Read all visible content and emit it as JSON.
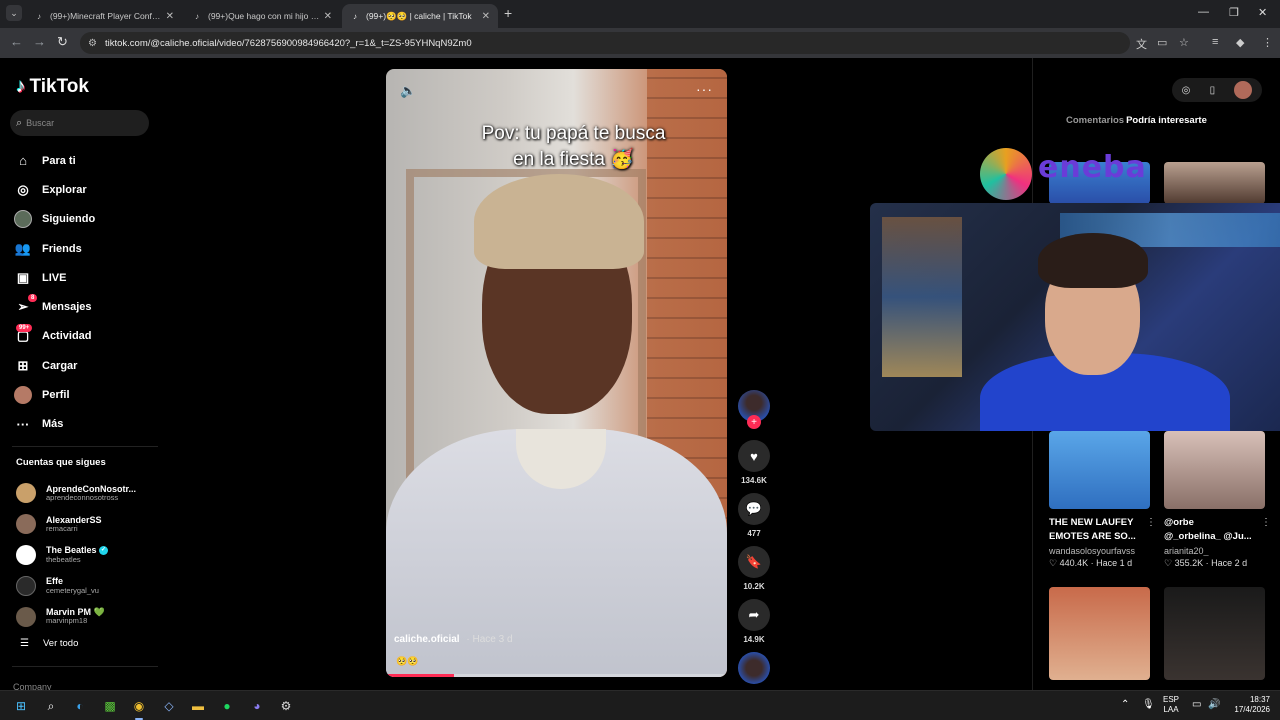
{
  "browser": {
    "tabs": [
      {
        "title": "(99+)Minecraft Player Confused",
        "active": false
      },
      {
        "title": "(99+)Que hago con mi hijo 😳 (",
        "active": false
      },
      {
        "title": "(99+)🥺🥺 | caliche | TikTok",
        "active": true
      }
    ],
    "url": "tiktok.com/@caliche.oficial/video/7628756900984966420?_r=1&_t=ZS-95YHNqN9Zm0"
  },
  "tiktok": {
    "logo": "TikTok",
    "search_placeholder": "Buscar",
    "nav": [
      {
        "label": "Para ti",
        "icon": "home-icon"
      },
      {
        "label": "Explorar",
        "icon": "compass-icon"
      },
      {
        "label": "Siguiendo",
        "icon": "following-avatar-icon"
      },
      {
        "label": "Friends",
        "icon": "friends-icon"
      },
      {
        "label": "LIVE",
        "icon": "live-icon"
      },
      {
        "label": "Mensajes",
        "icon": "messages-icon",
        "badge": "8"
      },
      {
        "label": "Actividad",
        "icon": "activity-icon",
        "badge": "99+"
      },
      {
        "label": "Cargar",
        "icon": "upload-icon"
      },
      {
        "label": "Perfil",
        "icon": "profile-avatar-icon"
      },
      {
        "label": "Más",
        "icon": "more-icon"
      }
    ],
    "following_title": "Cuentas que sigues",
    "following": [
      {
        "name": "AprendeConNosotr...",
        "handle": "aprendeconnosotross",
        "color": "#c9a06a"
      },
      {
        "name": "AlexanderSS",
        "handle": "remacarri",
        "color": "#8a6b5a"
      },
      {
        "name": "The Beatles",
        "handle": "thebeatles",
        "color": "#ffffff",
        "verified": true
      },
      {
        "name": "Effe",
        "handle": "cemeterygal_vu",
        "color": "#2a2a2a"
      },
      {
        "name": "Marvin PM 💚",
        "handle": "marvinpm18",
        "color": "#6a5a4a"
      }
    ],
    "see_all": "Ver todo",
    "company": "Company"
  },
  "video": {
    "caption_line1": "Pov: tu papá te busca",
    "caption_line2": "en la fiesta 🥳",
    "author": "caliche.oficial",
    "time": "· Hace 3 d",
    "emoji": "🥺🥺",
    "progress": 0.2,
    "likes": "134.6K",
    "comments": "477",
    "saves": "10.2K",
    "shares": "14.9K"
  },
  "right_panel": {
    "tabs": [
      "Comentarios",
      "Podría interesarte"
    ],
    "cards": [
      {
        "title": "THE NEW LAUFEY",
        "title2": "EMOTES ARE SO...",
        "author": "wandasolosyourfavss",
        "stats": "♡ 440.4K · Hace 1 d",
        "color": "#3a8ad8"
      },
      {
        "title": "@orbe",
        "title2": "@_orbelina_ @Ju...",
        "author": "arianita20_",
        "stats": "♡ 355.2K · Hace 2 d",
        "color": "#c8b0a8"
      }
    ],
    "overlay_word": "eneba"
  },
  "taskbar": {
    "lang": "ESP",
    "lang2": "LAA",
    "time": "18:37",
    "date": "17/4/2026"
  }
}
